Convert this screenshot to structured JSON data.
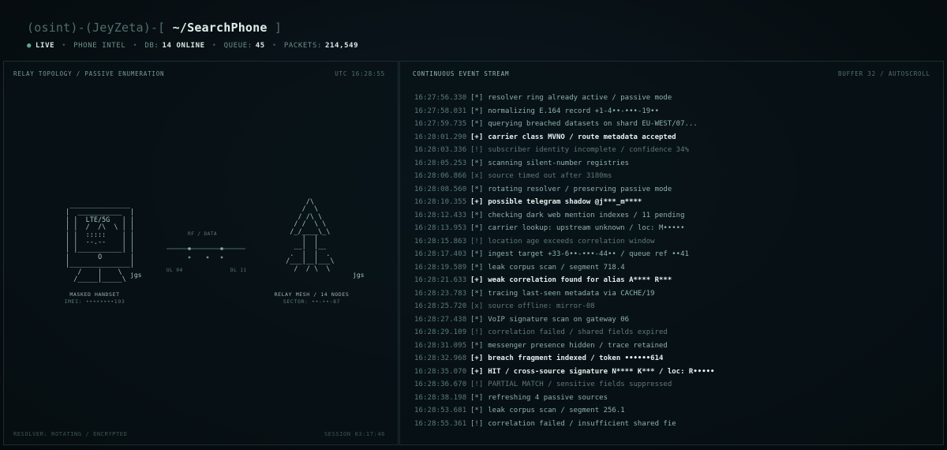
{
  "header": {
    "prompt_prefix": "(osint)-(JeyZeta)-[",
    "prompt_dir": " ~/SearchPhone",
    "prompt_suffix": " ]",
    "status": {
      "live": "LIVE",
      "mode": "PHONE INTEL",
      "db_label": "DB:",
      "db_value": "14 ONLINE",
      "queue_label": "QUEUE:",
      "queue_value": "45",
      "packets_label": "PACKETS:",
      "packets_value": "214,549"
    }
  },
  "left_panel": {
    "title": "RELAY TOPOLOGY / PASSIVE ENUMERATION",
    "clock": "UTC 16:28:55",
    "footer_left": "RESOLVER: ROTATING / ENCRYPTED",
    "footer_right": "SESSION 03:17:46",
    "handset_art": " _______________\n|  ___________  |\n| |  LTE/5G   | |\n| |  /  /\\  \\ | |\n| |  :::::    | |\n| |  --.--    | |\n| |___________| |\n|       O       |\n|_______________|\n   /    |    \\\n  /_____|_____\\",
    "handset_signature": "jgs",
    "handset_label": "MASKED HANDSET",
    "handset_imei": "IMEI: ••••••••193",
    "link_label": "RF / DATA",
    "link_left": "UL 04",
    "link_right": "DL 11",
    "mesh_art": "      /\\\n     /  \\\n    / /\\ \\\n   / /  \\ \\\n  /_/____\\_\\\n     |  |\n   __|  |__\n  .  |  |  .\n /___|__|___\\\n   /  / \\  \\",
    "mesh_signature": "jgs",
    "mesh_label": "RELAY MESH / 14 NODES",
    "mesh_sector": "SECTOR: ••-••-87"
  },
  "right_panel": {
    "title": "CONTINUOUS EVENT STREAM",
    "buffer": "BUFFER 32 / AUTOSCROLL",
    "events": [
      {
        "ts": "16:27:56.330",
        "tag": "[*]",
        "msg": "resolver ring already active / passive mode",
        "style": "normal"
      },
      {
        "ts": "16:27:58.031",
        "tag": "[*]",
        "msg": "normalizing E.164 record +1-4••-•••-19••",
        "style": "normal"
      },
      {
        "ts": "16:27:59.735",
        "tag": "[*]",
        "msg": "querying breached datasets on shard EU-WEST/07...",
        "style": "normal"
      },
      {
        "ts": "16:28:01.290",
        "tag": "[+]",
        "msg": "carrier class MVNO / route metadata accepted",
        "style": "bold"
      },
      {
        "ts": "16:28:03.336",
        "tag": "[!]",
        "msg": "subscriber identity incomplete / confidence 34%",
        "style": "dim"
      },
      {
        "ts": "16:28:05.253",
        "tag": "[*]",
        "msg": "scanning silent-number registries",
        "style": "normal"
      },
      {
        "ts": "16:28:06.866",
        "tag": "[x]",
        "msg": "source timed out after 3180ms",
        "style": "dim"
      },
      {
        "ts": "16:28:08.560",
        "tag": "[*]",
        "msg": "rotating resolver / preserving passive mode",
        "style": "normal"
      },
      {
        "ts": "16:28:10.355",
        "tag": "[+]",
        "msg": "possible telegram shadow @j***_m****",
        "style": "bold"
      },
      {
        "ts": "16:28:12.433",
        "tag": "[*]",
        "msg": "checking dark web mention indexes / 11 pending",
        "style": "normal"
      },
      {
        "ts": "16:28:13.953",
        "tag": "[*]",
        "msg": "carrier lookup: upstream unknown / loc: M•••••",
        "style": "normal"
      },
      {
        "ts": "16:28:15.863",
        "tag": "[!]",
        "msg": "location age exceeds correlation window",
        "style": "dim"
      },
      {
        "ts": "16:28:17.403",
        "tag": "[*]",
        "msg": "ingest target +33-6••-•••-44•• / queue ref ••41",
        "style": "normal"
      },
      {
        "ts": "16:28:19.589",
        "tag": "[*]",
        "msg": "leak corpus scan / segment 718.4",
        "style": "normal"
      },
      {
        "ts": "16:28:21.633",
        "tag": "[+]",
        "msg": "weak correlation found for alias A**** R***",
        "style": "bold"
      },
      {
        "ts": "16:28:23.783",
        "tag": "[*]",
        "msg": "tracing last-seen metadata via CACHE/19",
        "style": "normal"
      },
      {
        "ts": "16:28:25.720",
        "tag": "[x]",
        "msg": "source offline: mirror-08",
        "style": "dim"
      },
      {
        "ts": "16:28:27.438",
        "tag": "[*]",
        "msg": "VoIP signature scan on gateway 06",
        "style": "normal"
      },
      {
        "ts": "16:28:29.109",
        "tag": "[!]",
        "msg": "correlation failed / shared fields expired",
        "style": "dim"
      },
      {
        "ts": "16:28:31.095",
        "tag": "[*]",
        "msg": "messenger presence hidden / trace retained",
        "style": "normal"
      },
      {
        "ts": "16:28:32.968",
        "tag": "[+]",
        "msg": "breach fragment indexed / token ••••••614",
        "style": "bold"
      },
      {
        "ts": "16:28:35.070",
        "tag": "[+]",
        "msg": "HIT / cross-source signature N**** K*** / loc: R•••••",
        "style": "bold"
      },
      {
        "ts": "16:28:36.670",
        "tag": "[!]",
        "msg": "PARTIAL MATCH / sensitive fields suppressed",
        "style": "dim"
      },
      {
        "ts": "16:28:38.198",
        "tag": "[*]",
        "msg": "refreshing 4 passive sources",
        "style": "normal"
      },
      {
        "ts": "16:28:53.681",
        "tag": "[*]",
        "msg": "leak corpus scan / segment 256.1",
        "style": "normal"
      },
      {
        "ts": "16:28:55.361",
        "tag": "[!]",
        "msg": "correlation failed / insufficient shared fie",
        "style": "normal"
      }
    ]
  }
}
